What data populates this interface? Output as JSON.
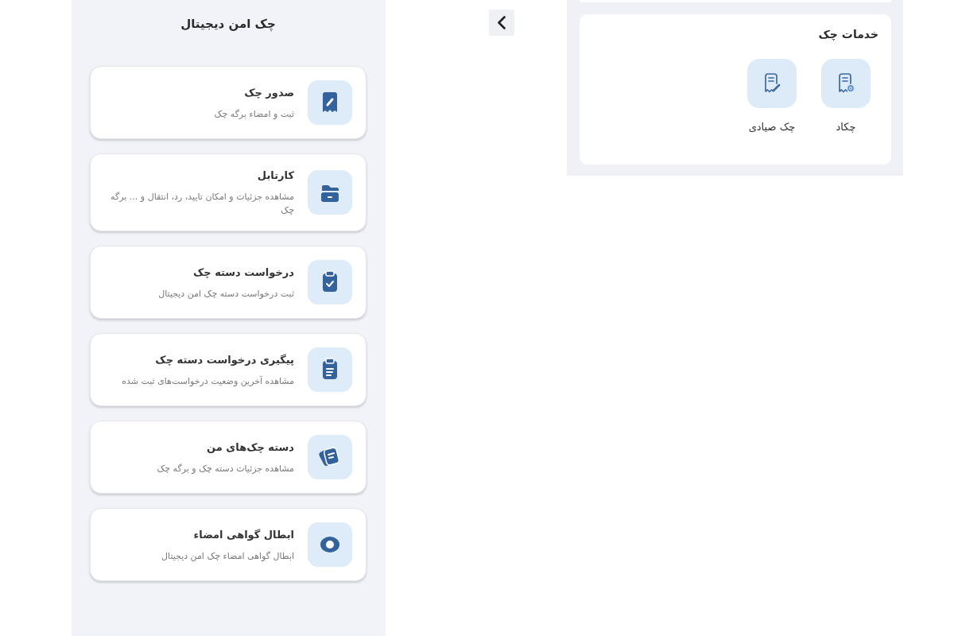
{
  "side_panel": {
    "title": "چک امن دیجیتال",
    "items": [
      {
        "title": "صدور چک",
        "description": "ثبت و امضاء برگه چک"
      },
      {
        "title": "کارتابل",
        "description": "مشاهده جزئیات و امکان تایید، رد، انتقال و ... برگه چک"
      },
      {
        "title": "درخواست دسته چک",
        "description": "ثبت درخواست دسته چک امن دیجیتال"
      },
      {
        "title": "پیگیری درخواست دسته چک",
        "description": "مشاهده آخرین وضعیت درخواست‌های ثبت شده"
      },
      {
        "title": "دسته چک‌های من",
        "description": "مشاهده جزئیات دسته چک و برگه چک"
      },
      {
        "title": "ابطال گواهی امضاء",
        "description": "ابطال گواهی امضاء چک امن دیجیتال"
      }
    ]
  },
  "services": {
    "title": "خدمات چک",
    "items": [
      {
        "label": "چکاد"
      },
      {
        "label": "چک صیادی"
      }
    ]
  }
}
